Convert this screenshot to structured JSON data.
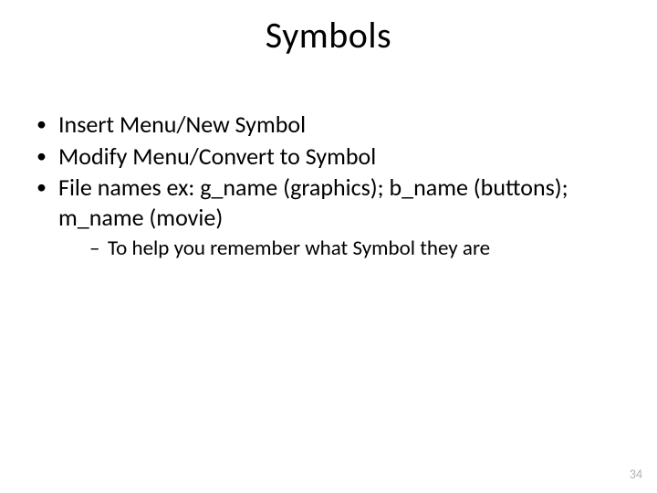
{
  "title": "Symbols",
  "bullets": {
    "b1": "Insert Menu/New Symbol",
    "b2": "Modify Menu/Convert to Symbol",
    "b3": "File names ex: g_name (graphics); b_name (buttons); m_name (movie)",
    "b3_sub1": "To help you remember what Symbol they are"
  },
  "page_number": "34"
}
